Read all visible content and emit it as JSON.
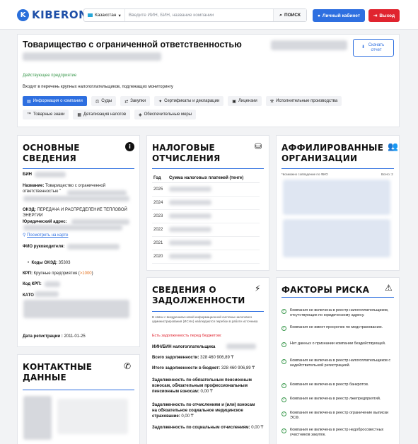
{
  "header": {
    "logo": "KIBERON",
    "country": "Казахстан",
    "search_placeholder": "Введите ИИН, БИН, название компании",
    "search_button": "ПОИСК",
    "cabinet_button": "Личный кабинет",
    "exit_button": "Выход"
  },
  "company": {
    "title": "Товарищество с ограниченной ответственностью",
    "title_quote": "\"",
    "download_button": "Скачать отчет",
    "status": "Действующее предприятие",
    "monitoring": "Входит в перечень крупных налогоплательщиков, подлежащих мониторингу",
    "tabs": [
      {
        "label": "Информация о компании",
        "icon": "document-icon"
      },
      {
        "label": "Суды",
        "icon": "court-icon"
      },
      {
        "label": "Закупки",
        "icon": "handshake-icon"
      },
      {
        "label": "Сертификаты и декларации",
        "icon": "certificate-icon"
      },
      {
        "label": "Лицензии",
        "icon": "license-icon"
      },
      {
        "label": "Исполнительные производства",
        "icon": "gavel-icon"
      },
      {
        "label": "Товарные знаки",
        "icon": "trademark-icon"
      },
      {
        "label": "Детализация налогов",
        "icon": "receipt-icon"
      },
      {
        "label": "Обеспечительные меры",
        "icon": "shield-icon"
      }
    ]
  },
  "basic": {
    "heading": "ОСНОВНЫЕ СВЕДЕНИЯ",
    "bin_label": "БИН",
    "name_label": "Название:",
    "name_value": "Товарищество с ограниченной ответственностью \"",
    "oked_label": "ОКЭД:",
    "oked_value": "ПЕРЕДАЧА И РАСПРЕДЕЛЕНИЕ ТЕПЛОВОЙ ЭНЕРГИИ",
    "address_label": "Юридический адрес:",
    "map_link": "Посмотреть на карте",
    "director_label": "ФИО руководителя:",
    "oked_codes_label": "Коды ОКЭД:",
    "oked_codes_value": "35303",
    "krp_label": "КРП:",
    "krp_value": "Крупные предприятия (",
    "krp_range": ">1000",
    "krp_close": ")",
    "krp_code_label": "Код КРП:",
    "kato_label": "КАТО",
    "reg_label": "Дата регистрации :",
    "reg_value": "2011-01-25"
  },
  "contacts": {
    "heading": "КОНТАКТНЫЕ ДАННЫЕ"
  },
  "taxes": {
    "heading": "НАЛОГОВЫЕ ОТЧИСЛЕНИЯ",
    "col_year": "Год",
    "col_sum": "Сумма налоговых платежей (тенге)",
    "years": [
      "2025",
      "2024",
      "2023",
      "2022",
      "2021",
      "2020"
    ]
  },
  "debt": {
    "heading": "СВЕДЕНИЯ О ЗАДОЛЖЕННОСТИ",
    "note": "В связи с внедрением новой информационной системы налогового администрирования (ИСНА) наблюдаются перебои в работе источника",
    "has_debt": "Есть задолженность перед бюджетом:",
    "iin_label": "ИИН/БИН налогоплательщика",
    "total_label": "Всего задолженности:",
    "total_value": "328 460 906,89 ₸",
    "budget_label": "Итого задолженности в бюджет:",
    "budget_value": "328 460 906,89 ₸",
    "pension_label": "Задолженность по обязательным пенсионным взносам, обязательным профессиональным пенсионным взносам:",
    "pension_value": "0,00 ₸",
    "medical_label": "Задолженность по отчислениям и (или) взносам на обязательное социальное медицинское страхование:",
    "medical_value": "0,00 ₸",
    "social_label": "Задолженность по социальным отчислениям:",
    "social_value": "0,00 ₸"
  },
  "affiliated": {
    "heading": "АФФИЛИРОВАННЫЕ ОРГАНИЗАЦИИ",
    "note": "*возможно совпадение по ФИО",
    "total": "Всего: 2"
  },
  "risks": {
    "heading": "ФАКТОРЫ РИСКА",
    "items": [
      "Компания не включена в реестр налогоплательщиков, отсутствующих по юридическому адресу.",
      "Компания не имеет просрочек по медстрахованию.",
      "Нет данных о признании компании бездействующей.",
      "Компания не включена в реестр налогоплательщиков с недействительной регистрацией.",
      "Компания не включена в реестр банкротов.",
      "Компания не включена в реестр лжепредприятий.",
      "Компания не включена в реестр ограничение выписки ЭСФ.",
      "Компания не включена в реестр недобросовестных участников закупок."
    ]
  },
  "colors": {
    "accent": "#2e6fe0",
    "danger": "#e0242f",
    "success": "#3d9a4f"
  }
}
